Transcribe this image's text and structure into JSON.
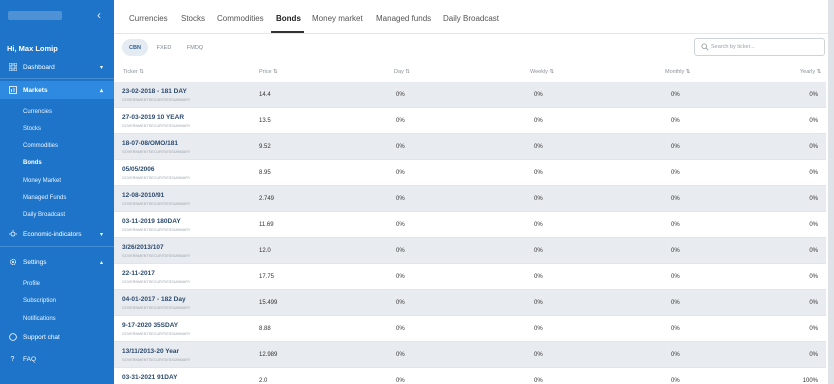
{
  "sidebar": {
    "collapse_icon": "chevron-left-icon",
    "greeting": "Hi, Max Lomip",
    "dashboard": {
      "label": "Dashboard",
      "icon": "grid-icon"
    },
    "markets": {
      "label": "Markets",
      "icon": "chart-icon"
    },
    "markets_sub": [
      "Currencies",
      "Stocks",
      "Commodities",
      "Bonds",
      "Money Market",
      "Managed Funds",
      "Daily Broadcast"
    ],
    "economic": {
      "label": "Economic-indicators",
      "icon": "bulb-icon"
    },
    "settings": {
      "label": "Settings",
      "icon": "gear-icon"
    },
    "settings_sub": [
      "Profile",
      "Subscription",
      "Notifications"
    ],
    "support": {
      "label": "Support chat",
      "icon": "chat-icon"
    },
    "faq": {
      "label": "FAQ",
      "icon": "question-icon"
    }
  },
  "tabs": [
    "Currencies",
    "Stocks",
    "Commodities",
    "Bonds",
    "Money market",
    "Managed funds",
    "Daily Broadcast"
  ],
  "selected_tab": "Bonds",
  "filters": [
    "CBN",
    "FXED",
    "FMDQ"
  ],
  "selected_filter": "CBN",
  "search": {
    "placeholder": "Search by ticker..."
  },
  "table": {
    "headers": [
      "Ticker ⇅",
      "Price ⇅",
      "Day ⇅",
      "Weekly ⇅",
      "Monthly ⇅",
      "Yearly ⇅"
    ],
    "sub_label": "GOVERNMENTSECURITIESSUMMARY",
    "rows": [
      {
        "ticker": "23-02-2018 - 181 DAY",
        "price": "14.4",
        "day": "0%",
        "weekly": "0%",
        "monthly": "0%",
        "yearly": "0%"
      },
      {
        "ticker": "27-03-2019 10 YEAR",
        "price": "13.5",
        "day": "0%",
        "weekly": "0%",
        "monthly": "0%",
        "yearly": "0%"
      },
      {
        "ticker": "18-07-08/OMO/181",
        "price": "9.52",
        "day": "0%",
        "weekly": "0%",
        "monthly": "0%",
        "yearly": "0%"
      },
      {
        "ticker": "05/05/2006",
        "price": "8.95",
        "day": "0%",
        "weekly": "0%",
        "monthly": "0%",
        "yearly": "0%"
      },
      {
        "ticker": "12-08-2010/91",
        "price": "2.749",
        "day": "0%",
        "weekly": "0%",
        "monthly": "0%",
        "yearly": "0%"
      },
      {
        "ticker": "03-11-2019 180DAY",
        "price": "11.69",
        "day": "0%",
        "weekly": "0%",
        "monthly": "0%",
        "yearly": "0%"
      },
      {
        "ticker": "3/26/2013/107",
        "price": "12.0",
        "day": "0%",
        "weekly": "0%",
        "monthly": "0%",
        "yearly": "0%"
      },
      {
        "ticker": "22-11-2017",
        "price": "17.75",
        "day": "0%",
        "weekly": "0%",
        "monthly": "0%",
        "yearly": "0%"
      },
      {
        "ticker": "04-01-2017 - 182 Day",
        "price": "15.499",
        "day": "0%",
        "weekly": "0%",
        "monthly": "0%",
        "yearly": "0%"
      },
      {
        "ticker": "9-17-2020 35SDAY",
        "price": "8.88",
        "day": "0%",
        "weekly": "0%",
        "monthly": "0%",
        "yearly": "0%"
      },
      {
        "ticker": "13/11/2013-20 Year",
        "price": "12.989",
        "day": "0%",
        "weekly": "0%",
        "monthly": "0%",
        "yearly": "0%"
      },
      {
        "ticker": "03-31-2021 91DAY",
        "price": "2.0",
        "day": "0%",
        "weekly": "0%",
        "monthly": "0%",
        "yearly": "100%"
      }
    ]
  }
}
